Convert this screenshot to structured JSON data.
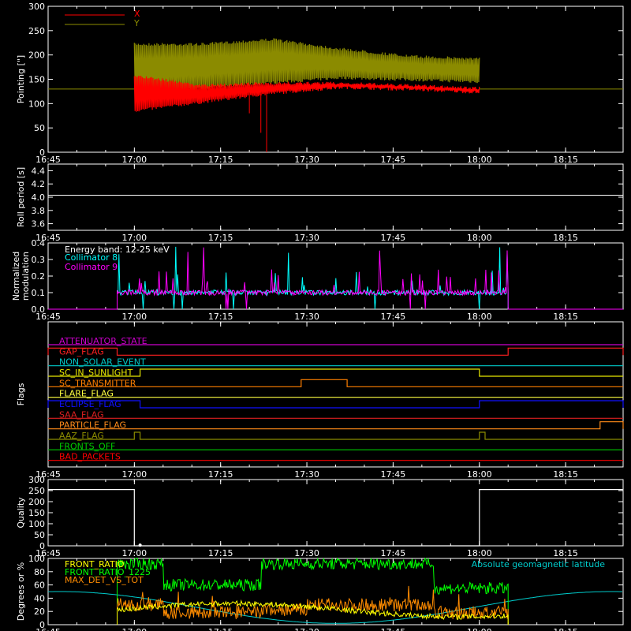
{
  "chart_data": [
    {
      "type": "line",
      "ylabel": "Pointing [\"]",
      "ylim": [
        0,
        300
      ],
      "yticks": [
        0,
        50,
        100,
        150,
        200,
        250,
        300
      ],
      "xticks": [
        "16:45",
        "17:00",
        "17:15",
        "17:30",
        "17:45",
        "18:00",
        "18:15"
      ],
      "x_range": [
        "16:45",
        "18:25"
      ],
      "legend": "top-left",
      "series": [
        {
          "name": "X",
          "color": "#ff0000",
          "data_range": [
            "17:00",
            "18:00"
          ],
          "low": [
            82,
            100,
            118,
            130,
            126,
            120
          ],
          "high": [
            160,
            140,
            145,
            145,
            140,
            135
          ],
          "outside_value": 130
        },
        {
          "name": "Y",
          "color": "#8b8b00",
          "data_range": [
            "17:00",
            "18:00"
          ],
          "low": [
            120,
            128,
            140,
            150,
            146,
            142
          ],
          "high": [
            225,
            225,
            235,
            215,
            200,
            195
          ],
          "outside_value": 130
        }
      ]
    },
    {
      "type": "line",
      "ylabel": "Roll period [s]",
      "ylim": [
        3.5,
        4.5
      ],
      "yticks": [
        3.6,
        3.8,
        4.0,
        4.2,
        4.4
      ],
      "xticks": [
        "16:45",
        "17:00",
        "17:15",
        "17:30",
        "17:45",
        "18:00",
        "18:15"
      ],
      "series": [
        {
          "name": "",
          "color": "#ffffff",
          "values": [
            4.03,
            4.03
          ]
        }
      ]
    },
    {
      "type": "line",
      "ylabel": "Normalized modulation",
      "ylim": [
        0,
        0.4
      ],
      "yticks": [
        0.0,
        0.1,
        0.2,
        0.3,
        0.4
      ],
      "xticks": [
        "16:45",
        "17:00",
        "17:15",
        "17:30",
        "17:45",
        "18:00",
        "18:15"
      ],
      "annotation": "Energy band: 12-25 keV",
      "legend": "top-left",
      "series": [
        {
          "name": "Collimator 8",
          "color": "#00ffff",
          "data_range": [
            "16:57",
            "18:05"
          ],
          "baseline": 0.1
        },
        {
          "name": "Collimator 9",
          "color": "#ff00ff",
          "data_range": [
            "16:57",
            "18:05"
          ],
          "baseline": 0.1
        }
      ]
    },
    {
      "type": "line",
      "ylabel": "Flags",
      "xticks": [
        "16:45",
        "17:00",
        "17:15",
        "17:30",
        "17:45",
        "18:00",
        "18:15"
      ],
      "series": [
        {
          "name": "ATTENUATOR_STATE",
          "color": "#cc00cc",
          "high": []
        },
        {
          "name": "GAP_FLAG",
          "color": "#ff2020",
          "high": [
            [
              "16:45",
              "16:57"
            ],
            [
              "18:05",
              "18:25"
            ]
          ]
        },
        {
          "name": "NON_SOLAR_EVENT",
          "color": "#00c8c8",
          "high": []
        },
        {
          "name": "SC_IN_SUNLIGHT",
          "color": "#e8e800",
          "high": [
            [
              "17:01",
              "18:00"
            ]
          ]
        },
        {
          "name": "SC_TRANSMITTER",
          "color": "#ff7f00",
          "high": [
            [
              "17:29",
              "17:37"
            ]
          ]
        },
        {
          "name": "FLARE_FLAG",
          "color": "#ffff40",
          "high": []
        },
        {
          "name": "ECLIPSE_FLAG",
          "color": "#1010ff",
          "high": [
            [
              "16:45",
              "17:01"
            ],
            [
              "18:00",
              "18:25"
            ]
          ]
        },
        {
          "name": "SAA_FLAG",
          "color": "#dd2020",
          "high": []
        },
        {
          "name": "PARTICLE_FLAG",
          "color": "#ff8c1a",
          "high": [
            [
              "18:21",
              "18:25"
            ]
          ]
        },
        {
          "name": "AAZ_FLAG",
          "color": "#8b8b00",
          "high": [
            [
              "17:00",
              "17:01"
            ],
            [
              "18:00",
              "18:01"
            ]
          ]
        },
        {
          "name": "FRONTS_OFF",
          "color": "#00cc00",
          "high": []
        },
        {
          "name": "BAD_PACKETS",
          "color": "#ff0000",
          "high": []
        }
      ]
    },
    {
      "type": "line",
      "ylabel": "Quality",
      "ylim": [
        0,
        300
      ],
      "yticks": [
        0,
        50,
        100,
        150,
        200,
        250,
        300
      ],
      "xticks": [
        "16:45",
        "17:00",
        "17:15",
        "17:30",
        "17:45",
        "18:00",
        "18:15"
      ],
      "series": [
        {
          "name": "",
          "color": "#ffffff",
          "points": [
            [
              "16:45",
              255
            ],
            [
              "17:00",
              255
            ],
            [
              "17:00",
              0
            ],
            [
              "18:00",
              0
            ],
            [
              "18:00",
              255
            ],
            [
              "18:25",
              255
            ]
          ]
        }
      ]
    },
    {
      "type": "line",
      "ylabel": "Degrees or %",
      "ylim": [
        0,
        100
      ],
      "yticks": [
        0,
        20,
        40,
        60,
        80,
        100
      ],
      "xticks": [
        "16:45",
        "17:00",
        "17:15",
        "17:30",
        "17:45",
        "18:00",
        "18:15"
      ],
      "legend": "top-left",
      "series": [
        {
          "name": "FRONT_RATIO",
          "color": "#ffff00",
          "data_range": [
            "16:57",
            "18:05"
          ]
        },
        {
          "name": "FRONT_RATIO_1225",
          "color": "#00ff00",
          "data_range": [
            "16:57",
            "18:05"
          ],
          "levels": [
            [
              "16:57",
              92
            ],
            [
              "17:05",
              60
            ],
            [
              "17:22",
              92
            ],
            [
              "17:52",
              55
            ],
            [
              "18:05",
              55
            ]
          ]
        },
        {
          "name": "MAX_DET_VS_TOT",
          "color": "#ff8c00",
          "data_range": [
            "16:57",
            "18:05"
          ],
          "levels": [
            [
              "16:57",
              30
            ],
            [
              "17:05",
              18
            ],
            [
              "17:22",
              22
            ],
            [
              "17:30",
              30
            ],
            [
              "17:52",
              18
            ],
            [
              "18:05",
              18
            ]
          ]
        },
        {
          "name": "Absolute geomagnetic latitude",
          "color": "#00cccc",
          "note": "sinusoid between ~2 and ~50 degrees, period ~96 min"
        }
      ]
    }
  ]
}
